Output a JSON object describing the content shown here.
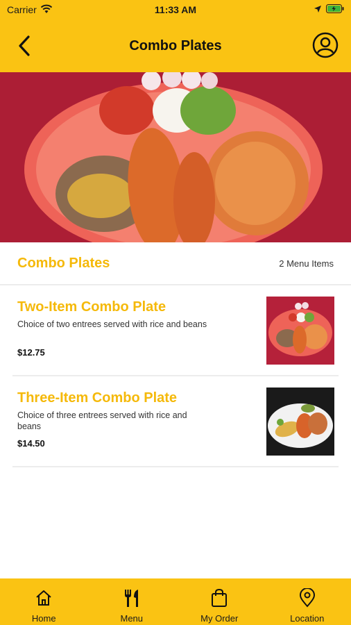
{
  "status_bar": {
    "carrier": "Carrier",
    "time": "11:33 AM"
  },
  "header": {
    "title": "Combo Plates"
  },
  "section": {
    "title": "Combo Plates",
    "count": "2 Menu Items"
  },
  "items": [
    {
      "name": "Two-Item Combo Plate",
      "description": "Choice of two entrees served with rice and beans",
      "price": "$12.75"
    },
    {
      "name": "Three-Item Combo Plate",
      "description": "Choice of three entrees served with rice and beans",
      "price": "$14.50"
    }
  ],
  "tabs": [
    {
      "label": "Home",
      "icon": "home-icon"
    },
    {
      "label": "Menu",
      "icon": "fork-knife-icon"
    },
    {
      "label": "My Order",
      "icon": "shopping-bag-icon"
    },
    {
      "label": "Location",
      "icon": "location-pin-icon"
    }
  ],
  "colors": {
    "brand": "#FAC313",
    "accent": "#F5B90A"
  }
}
